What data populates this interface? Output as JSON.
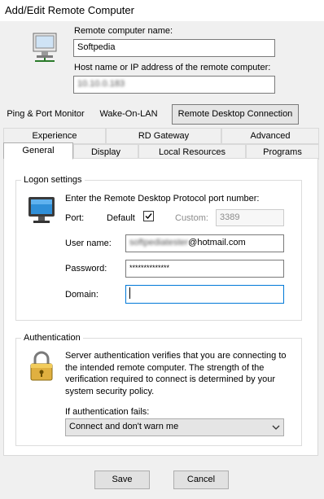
{
  "window": {
    "title": "Add/Edit Remote Computer"
  },
  "computer_name": {
    "label": "Remote computer name:",
    "value": "Softpedia"
  },
  "host": {
    "label": "Host name or IP address of the remote computer:",
    "value": "10.10.0.183"
  },
  "top_tabs": [
    "Ping & Port Monitor",
    "Wake-On-LAN",
    "Remote Desktop Connection"
  ],
  "sub_tabs_row1": [
    "Experience",
    "RD Gateway",
    "Advanced"
  ],
  "sub_tabs_row2": [
    "General",
    "Display",
    "Local Resources",
    "Programs"
  ],
  "logon": {
    "title": "Logon settings",
    "port_prompt": "Enter the Remote Desktop Protocol port number:",
    "port_label": "Port:",
    "default_label": "Default",
    "default_checked": true,
    "custom_label": "Custom:",
    "custom_value": "3389",
    "user_label": "User name:",
    "user_value_hidden": "softpediatester",
    "user_value_domain": "@hotmail.com",
    "password_label": "Password:",
    "password_value": "**************",
    "domain_label": "Domain:",
    "domain_value": ""
  },
  "auth": {
    "title": "Authentication",
    "description": "Server authentication verifies that you are connecting to the intended remote computer. The strength of the verification required to connect is determined by your system security policy.",
    "fail_label": "If authentication fails:",
    "fail_value": "Connect and don't warn me"
  },
  "buttons": {
    "save": "Save",
    "cancel": "Cancel"
  },
  "colors": {
    "focus_border": "#0078d7",
    "accent": "#0078d7"
  }
}
